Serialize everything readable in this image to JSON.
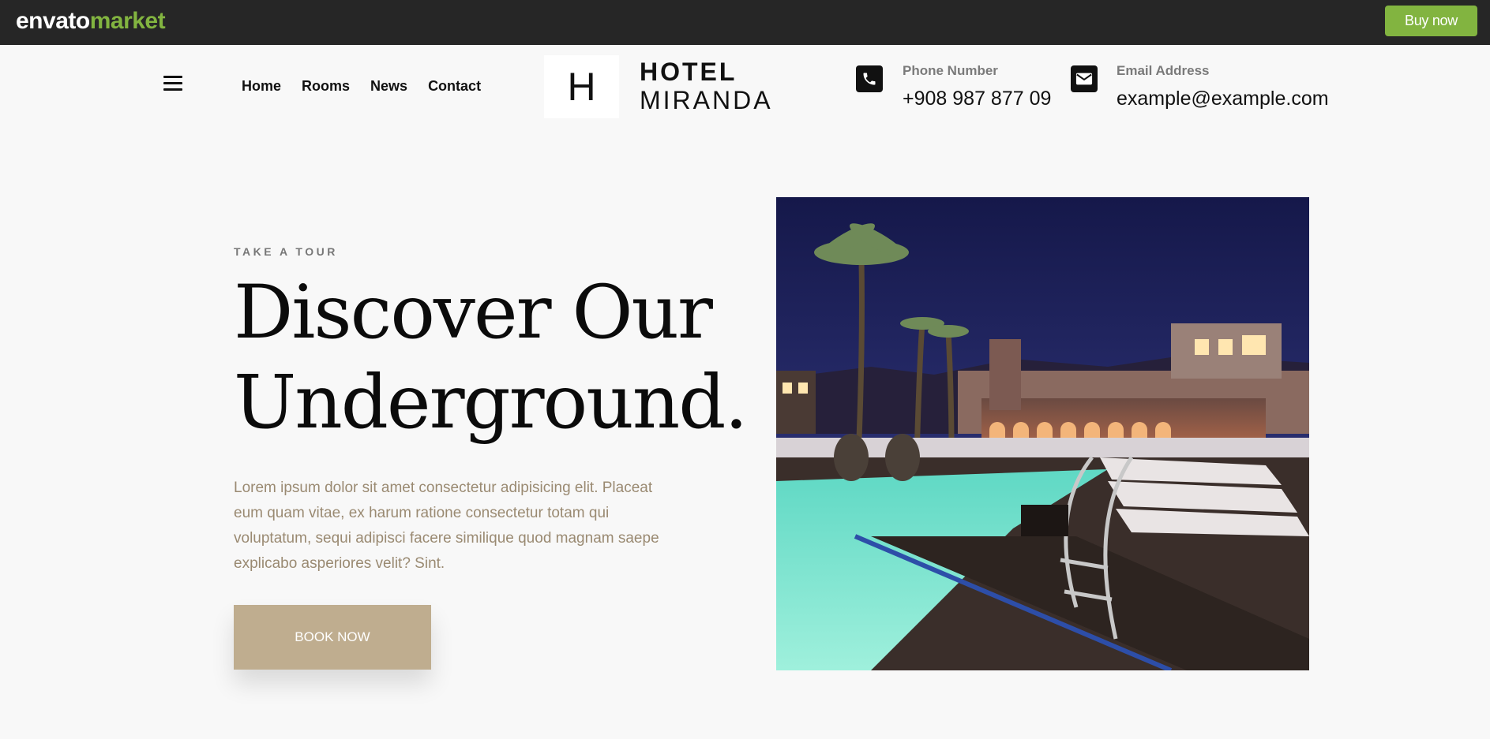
{
  "envato_bar": {
    "logo_part1": "envato",
    "logo_part2": "market",
    "buy_label": "Buy now",
    "accent_color": "#82b440"
  },
  "header": {
    "menu_icon": "hamburger-icon",
    "nav": [
      "Home",
      "Rooms",
      "News",
      "Contact"
    ],
    "logo_letter": "H",
    "brand_line1": "HOTEL",
    "brand_line2": "MIRANDA",
    "phone": {
      "icon": "phone-icon",
      "label": "Phone Number",
      "value": "+908 987 877 09"
    },
    "email": {
      "icon": "envelope-icon",
      "label": "Email Address",
      "value": "example@example.com"
    }
  },
  "hero": {
    "eyebrow": "TAKE A TOUR",
    "headline_line1": "Discover Our",
    "headline_line2": "Underground.",
    "body": "Lorem ipsum dolor sit amet consectetur adipisicing elit. Placeat eum quam vitae, ex harum ratione consectetur totam qui voluptatum, sequi adipisci facere similique quod magnam saepe explicabo asperiores velit? Sint.",
    "cta_label": "BOOK NOW",
    "cta_color": "#bfad8f",
    "image": "hotel-pool-night-photo"
  }
}
